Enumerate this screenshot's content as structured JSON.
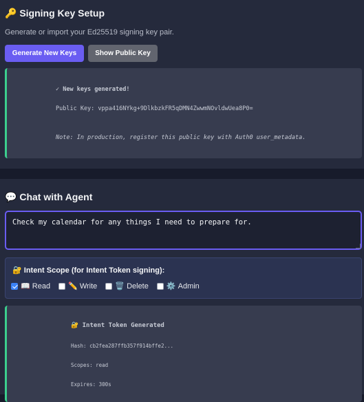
{
  "signing": {
    "title": "Signing Key Setup",
    "title_icon": "key-icon",
    "subtitle": "Generate or import your Ed25519 signing key pair.",
    "generate_label": "Generate New Keys",
    "show_label": "Show Public Key",
    "result": {
      "status": "✓ New keys generated!",
      "public_key": "Public Key: vppa416NYkg+9DlkbzkFR5qDMN4ZwwmNOvldwUea8P0=",
      "note": "Note: In production, register this public key with Auth0 user_metadata."
    }
  },
  "chat": {
    "title": "Chat with Agent",
    "title_icon": "speech-bubble-icon",
    "message": "Check my calendar for any things I need to prepare for.",
    "scope": {
      "title": "Intent Scope (for Intent Token signing):",
      "title_icon": "lock-key-icon",
      "options": [
        {
          "label": "Read",
          "icon": "book-icon",
          "checked": true
        },
        {
          "label": "Write",
          "icon": "pencil-icon",
          "checked": false
        },
        {
          "label": "Delete",
          "icon": "trash-icon",
          "checked": false
        },
        {
          "label": "Admin",
          "icon": "gear-icon",
          "checked": false
        }
      ]
    },
    "token": {
      "title": "Intent Token Generated",
      "title_icon": "lock-key-icon",
      "hash": "Hash: cb2fea287ffb357f914bffe2...",
      "scopes": "Scopes: read",
      "expires": "Expires: 300s"
    }
  },
  "colors": {
    "accent": "#6a5df2",
    "success": "#3ccf8e",
    "checkbox": "#3b82f6"
  }
}
